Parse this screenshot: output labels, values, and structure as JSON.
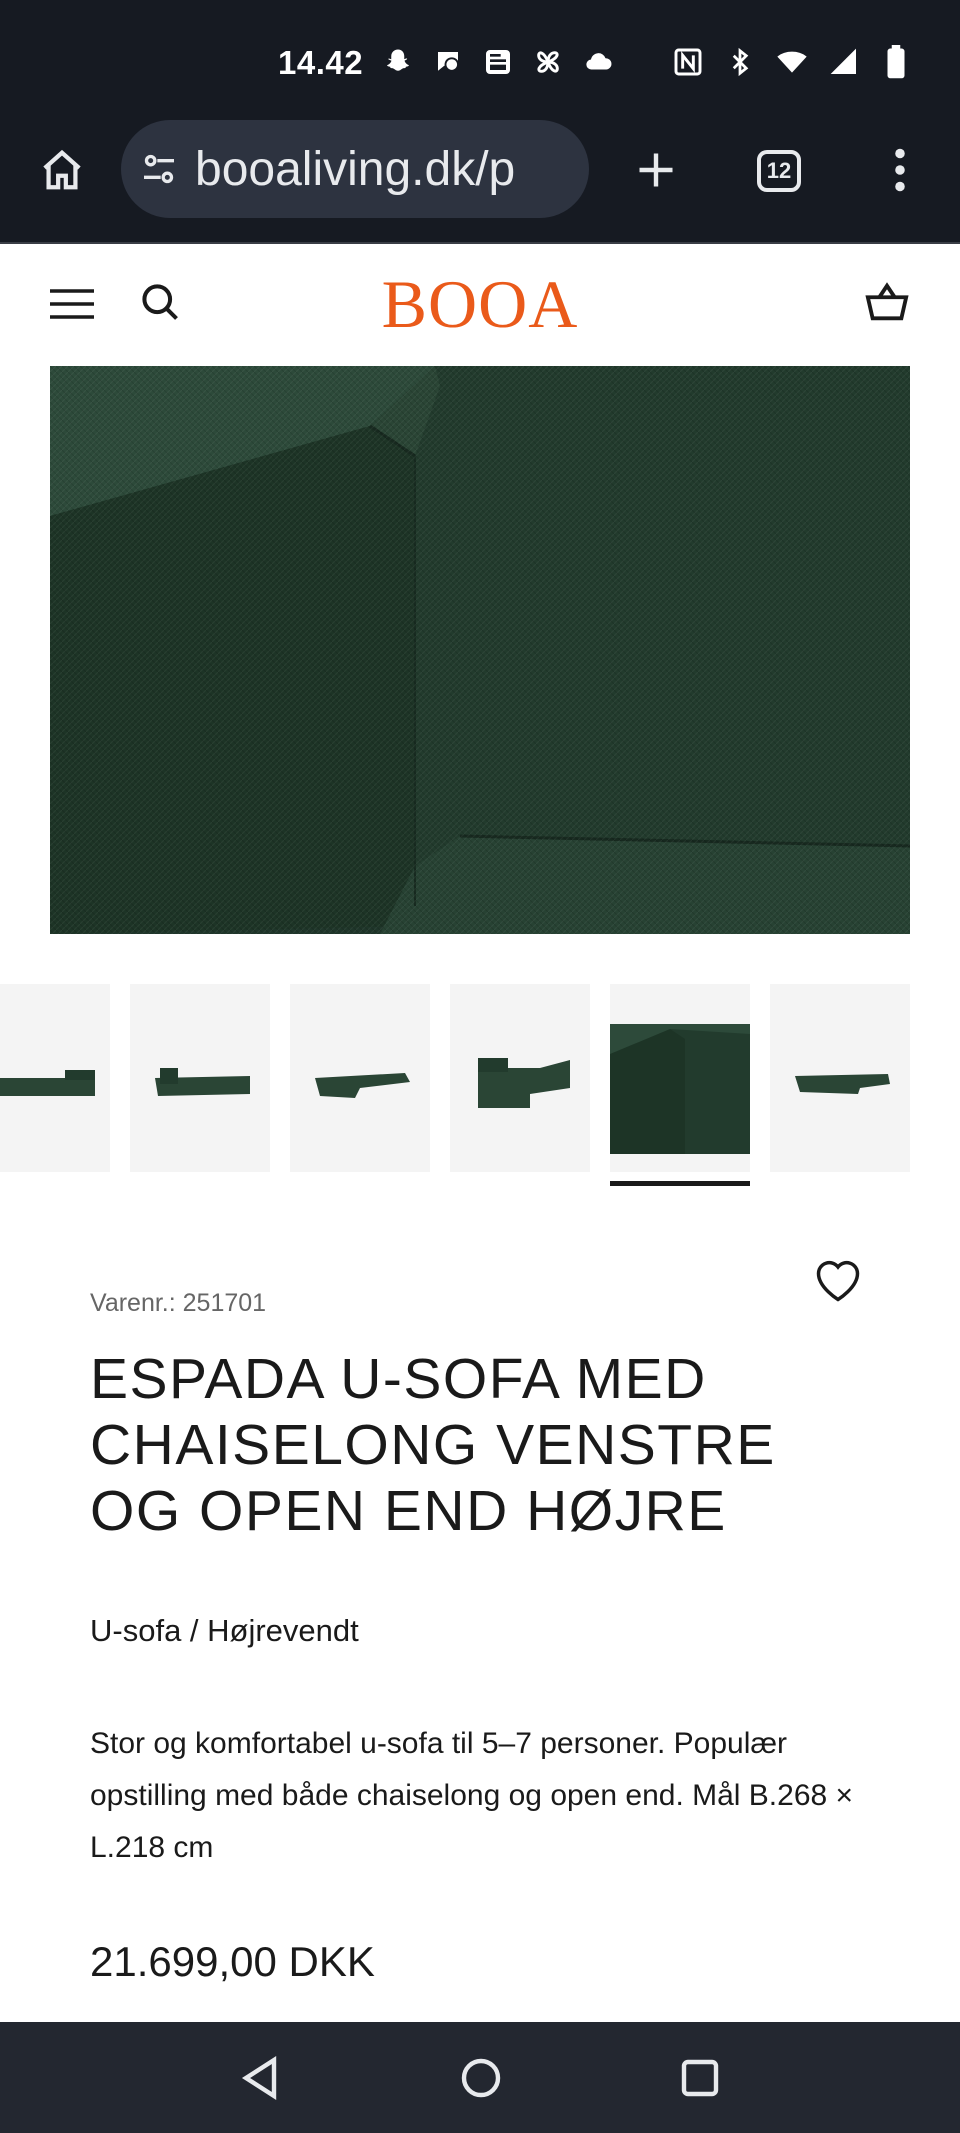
{
  "status_bar": {
    "time": "14.42",
    "icons_left": [
      "snapchat-icon",
      "chat-icon",
      "news-icon",
      "pinwheel-icon",
      "cloud-icon"
    ],
    "icons_right": [
      "nfc-icon",
      "bluetooth-icon",
      "wifi-icon",
      "signal-icon",
      "battery-icon"
    ]
  },
  "browser": {
    "url": "booaliving.dk/p",
    "tab_count": "12"
  },
  "site": {
    "logo": "BOOA"
  },
  "gallery": {
    "thumbnail_count": 6,
    "active_index": 4
  },
  "product": {
    "sku": "Varenr.: 251701",
    "title": "ESPADA U-SOFA MED CHAISELONG VENSTRE OG OPEN END HØJRE",
    "variant": "U-sofa / Højrevendt",
    "description": "Stor og komfortabel u-sofa til 5–7 personer. Populær opstilling med både chaiselong og open end. Mål B.268 × L.218 cm",
    "price": "21.699,00 DKK"
  },
  "colors": {
    "brand": "#ea5a1a",
    "sofa_green": "#223a2d",
    "chrome_dark": "#161a22"
  }
}
